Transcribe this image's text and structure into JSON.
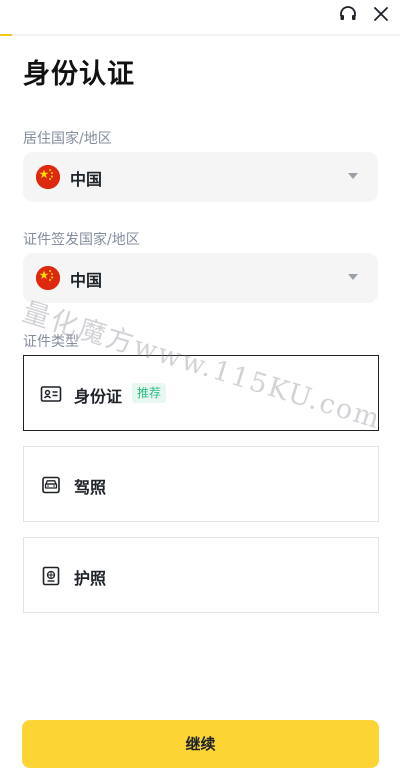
{
  "progress": {
    "fraction": 0.03
  },
  "header": {
    "support_icon": "headset-icon",
    "close_icon": "close-icon"
  },
  "page": {
    "title": "身份认证"
  },
  "residence": {
    "label": "居住国家/地区",
    "value": "中国",
    "flag_icon": "china-flag-icon"
  },
  "issuing": {
    "label": "证件签发国家/地区",
    "value": "中国",
    "flag_icon": "china-flag-icon"
  },
  "document_type": {
    "label": "证件类型",
    "options": [
      {
        "label": "身份证",
        "icon": "id-card-icon",
        "badge": "推荐",
        "selected": true
      },
      {
        "label": "驾照",
        "icon": "car-icon",
        "badge": "",
        "selected": false
      },
      {
        "label": "护照",
        "icon": "passport-icon",
        "badge": "",
        "selected": false
      }
    ]
  },
  "watermark": {
    "text": "量化魔方www.115KU.com"
  },
  "footer": {
    "continue_label": "继续"
  },
  "colors": {
    "accent": "#fcd535",
    "progress": "#f0c91a",
    "badge_text": "#2ebd85",
    "badge_bg": "#e8f8f1",
    "flag_red": "#de2910",
    "flag_yellow": "#ffde00"
  }
}
